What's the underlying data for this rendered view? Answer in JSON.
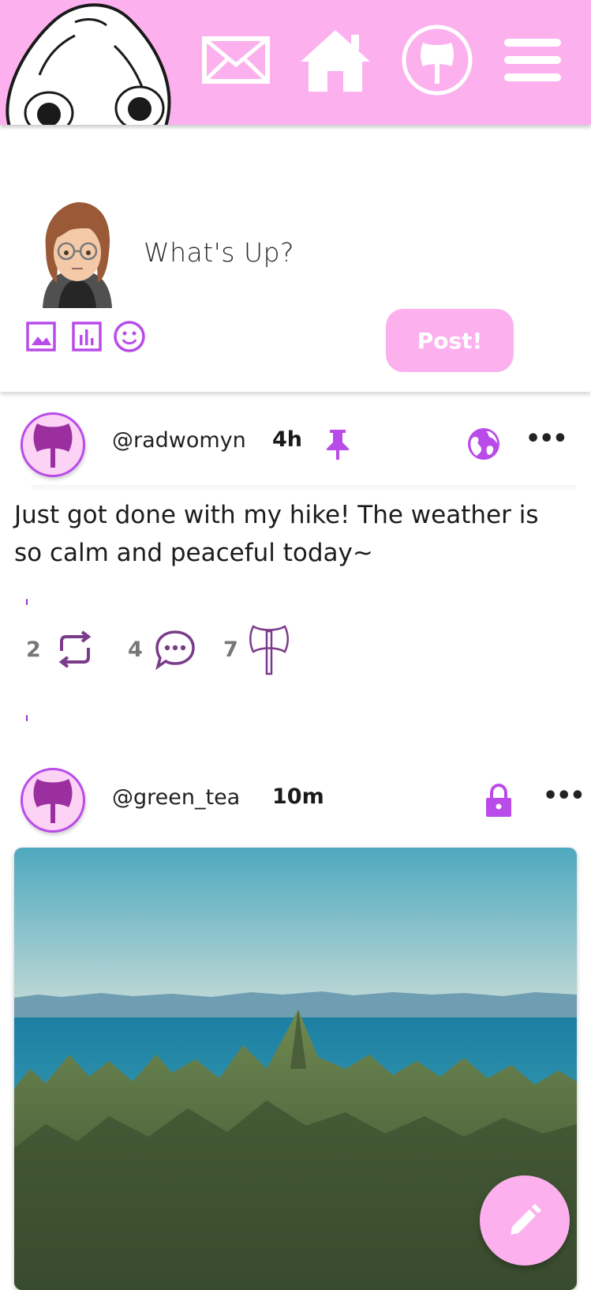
{
  "topbar": {
    "icons": [
      "mascot-icon",
      "mail-icon",
      "home-icon",
      "axe-circle-icon",
      "hamburger-menu-icon"
    ]
  },
  "composer": {
    "placeholder": "What's Up?",
    "tools": [
      "image-icon",
      "poll-icon",
      "emoji-icon"
    ],
    "post_label": "Post!"
  },
  "posts": [
    {
      "handle": "@radwomyn",
      "time": "4h",
      "icons": [
        "pin-icon",
        "globe-icon",
        "more-icon"
      ],
      "text": "Just got done with my hike! The weather is so calm and peaceful today~",
      "actions": {
        "reposts": "2",
        "comments": "4",
        "axes": "7"
      }
    },
    {
      "handle": "@green_tea",
      "time": "10m",
      "icons": [
        "lock-icon",
        "more-icon"
      ],
      "image": "forest-lake-landscape"
    }
  ],
  "colors": {
    "accent_pink": "#fcb1ee",
    "accent_purple": "#b94be9",
    "avatar_fill": "#fcd2f5"
  },
  "fab": {
    "icon": "pencil-icon"
  }
}
